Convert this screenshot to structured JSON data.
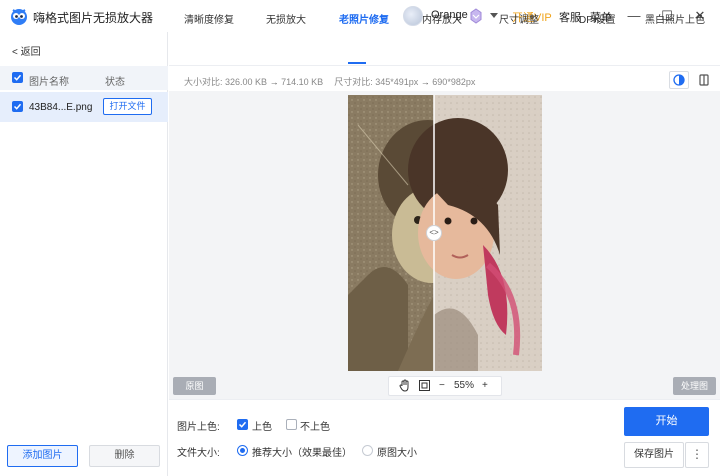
{
  "app": {
    "title": "嗨格式图片无损放大器",
    "user_name": "Orange",
    "vip_link": "开通VIP",
    "support": "客服",
    "menu": "菜单",
    "minimize": "—",
    "maximize": "☐",
    "close": "✕"
  },
  "sidebar": {
    "back_label": "返回",
    "header_name": "图片名称",
    "header_state": "状态",
    "files": [
      {
        "name": "43B84...E.png",
        "action": "打开文件"
      }
    ],
    "add_button": "添加图片",
    "delete_button": "删除"
  },
  "tabs": [
    {
      "label": "清晰度修复",
      "active": false
    },
    {
      "label": "无损放大",
      "active": false
    },
    {
      "label": "老照片修复",
      "active": true
    },
    {
      "label": "内存放大",
      "active": false
    },
    {
      "label": "尺寸调整",
      "active": false
    },
    {
      "label": "DPI设置",
      "active": false
    },
    {
      "label": "黑白照片上色",
      "active": false
    }
  ],
  "info": {
    "size_label": "大小对比:",
    "size_from": "326.00 KB",
    "size_to": "714.10 KB",
    "dim_label": "尺寸对比:",
    "dim_from": "345*491px",
    "dim_to": "690*982px"
  },
  "preview": {
    "original_label": "原图",
    "processed_label": "处理图",
    "zoom_value": "55%",
    "zoom_minus": "−",
    "zoom_plus": "+"
  },
  "options": {
    "colorize_label": "图片上色:",
    "colorize_yes": "上色",
    "colorize_no": "不上色",
    "colorize_selected": "上色",
    "filesize_label": "文件大小:",
    "filesize_recommended": "推荐大小（效果最佳）",
    "filesize_original": "原图大小",
    "filesize_selected": "推荐大小（效果最佳）"
  },
  "actions": {
    "start": "开始",
    "save": "保存图片",
    "more": "⋮"
  },
  "colors": {
    "accent": "#1f6cf1",
    "vip": "#f0a31a"
  }
}
